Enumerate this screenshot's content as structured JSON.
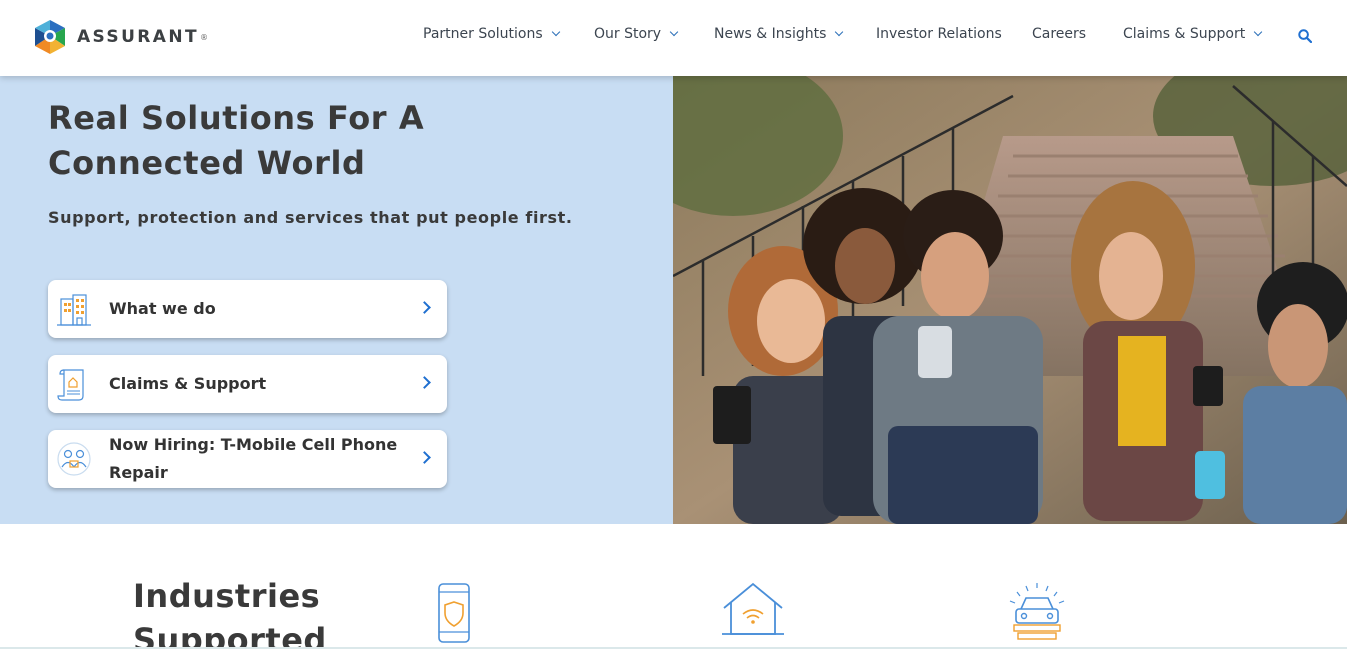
{
  "brand": {
    "name": "ASSURANT",
    "reg": "®"
  },
  "nav": {
    "items": [
      {
        "label": "Partner Solutions",
        "dropdown": true
      },
      {
        "label": "Our Story",
        "dropdown": true
      },
      {
        "label": "News & Insights",
        "dropdown": true
      },
      {
        "label": "Investor Relations",
        "dropdown": false
      },
      {
        "label": "Careers",
        "dropdown": false
      },
      {
        "label": "Claims & Support",
        "dropdown": true
      }
    ],
    "search_icon": "search-icon"
  },
  "hero": {
    "title": "Real Solutions For A Connected World",
    "subtitle": "Support, protection and services that put people first.",
    "cards": [
      {
        "label": "What we do",
        "icon": "building-icon"
      },
      {
        "label": "Claims & Support",
        "icon": "document-icon"
      },
      {
        "label": "Now Hiring: T-Mobile Cell Phone Repair",
        "icon": "people-icon"
      }
    ],
    "image": "group of friends looking at phones on stairs"
  },
  "industries": {
    "title": "Industries Supported",
    "icons": [
      "mobile-shield-icon",
      "connected-home-icon",
      "car-icon"
    ]
  },
  "colors": {
    "accent": "#1f6fd0",
    "hero_bg": "#c8ddf3",
    "text": "#3a3a3a",
    "icon_blue": "#4a8fd9",
    "icon_orange": "#f0a030"
  }
}
